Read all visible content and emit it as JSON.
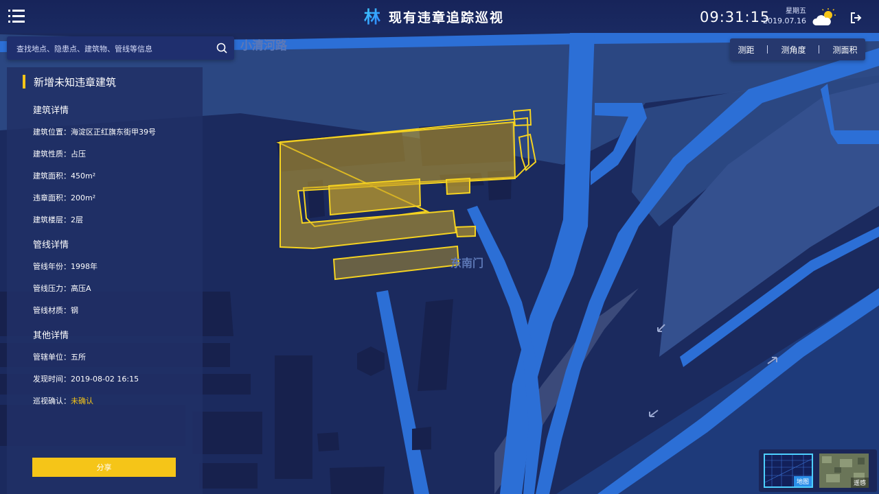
{
  "header": {
    "title": "现有违章追踪巡视",
    "logo_text": "林",
    "time": "09:31:15",
    "weekday": "星期五",
    "date": "2019.07.16"
  },
  "search": {
    "placeholder": "查找地点、隐患点、建筑物、管线等信息"
  },
  "tools": {
    "measure_distance": "测距",
    "measure_angle": "测角度",
    "measure_area": "测面积"
  },
  "map": {
    "labels": {
      "road": "小清河路",
      "gate": "东南门"
    },
    "colors": {
      "background": "#1b2a5e",
      "road": "#2c6fd6",
      "building": "#17214d",
      "highlight": "#f5c518"
    }
  },
  "panel": {
    "title": "新增未知违章建筑",
    "building": {
      "heading": "建筑详情",
      "rows": [
        {
          "label": "建筑位置：",
          "value": "海淀区正红旗东街甲39号"
        },
        {
          "label": "建筑性质：",
          "value": "占压"
        },
        {
          "label": "建筑面积：",
          "value": "450m²"
        },
        {
          "label": "违章面积：",
          "value": "200m²"
        },
        {
          "label": "建筑楼层：",
          "value": "2层"
        }
      ]
    },
    "pipeline": {
      "heading": "管线详情",
      "rows": [
        {
          "label": "管线年份：",
          "value": "1998年"
        },
        {
          "label": "管线压力：",
          "value": "高压A"
        },
        {
          "label": "管线材质：",
          "value": "钢"
        }
      ]
    },
    "other": {
      "heading": "其他详情",
      "rows": [
        {
          "label": "管辖单位：",
          "value": "五所"
        },
        {
          "label": "发现时间：",
          "value": "2019-08-02 16:15"
        },
        {
          "label": "巡视确认：",
          "value": "未确认"
        }
      ]
    },
    "share": "分享"
  },
  "layers": {
    "map": "地图",
    "satellite": "遥感"
  }
}
